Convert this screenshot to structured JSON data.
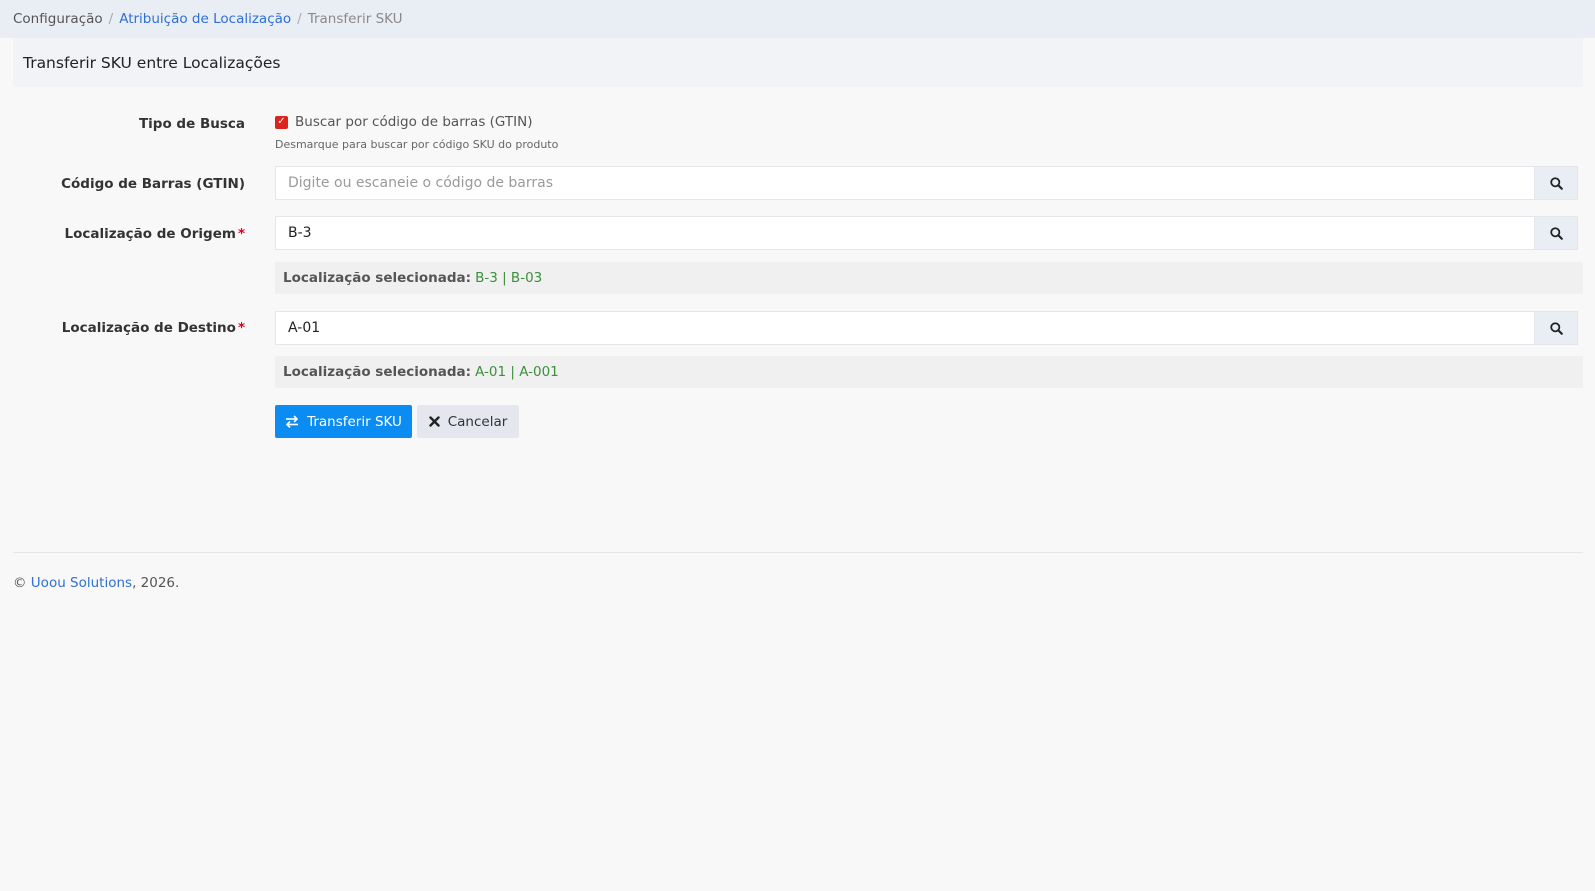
{
  "breadcrumb": {
    "items": [
      "Configuração",
      "Atribuição de Localização",
      "Transferir SKU"
    ]
  },
  "panel": {
    "title": "Transferir SKU entre Localizações"
  },
  "form": {
    "search_type": {
      "label": "Tipo de Busca",
      "checkbox_label": "Buscar por código de barras (GTIN)",
      "checked": true,
      "hint": "Desmarque para buscar por código SKU do produto"
    },
    "barcode": {
      "label": "Código de Barras (GTIN)",
      "value": "",
      "placeholder": "Digite ou escaneie o código de barras"
    },
    "origin": {
      "label": "Localização de Origem",
      "required_mark": "*",
      "value": "B-3",
      "selected_label": "Localização selecionada:",
      "selected_value": "B-3 | B-03"
    },
    "destination": {
      "label": "Localização de Destino",
      "required_mark": "*",
      "value": "A-01",
      "selected_label": "Localização selecionada:",
      "selected_value": "A-01 | A-001"
    },
    "buttons": {
      "transfer": "Transferir SKU",
      "cancel": "Cancelar"
    }
  },
  "footer": {
    "copyright": "©",
    "company": "Uoou Solutions",
    "year_suffix": ", 2026."
  },
  "colors": {
    "primary": "#0b8cf2",
    "link": "#2f6fd6",
    "checkbox": "#d9251d",
    "selected_value": "#3c8f3c",
    "required": "#d9001b"
  }
}
